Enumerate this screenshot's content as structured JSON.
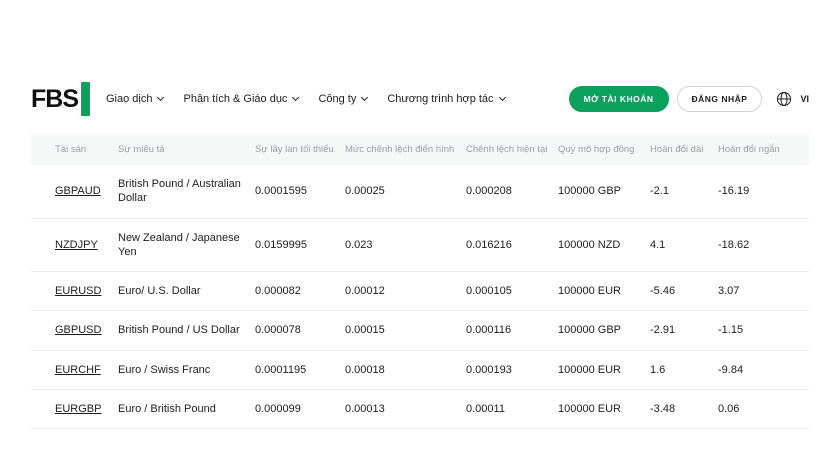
{
  "header": {
    "logo_text": "FBS",
    "nav_items": [
      {
        "label": "Giao dịch"
      },
      {
        "label": "Phân tích & Giáo dục"
      },
      {
        "label": "Công ty"
      },
      {
        "label": "Chương trình hợp tác"
      }
    ],
    "open_account_label": "MỞ TÀI KHOẢN",
    "login_label": "ĐĂNG NHẬP",
    "language": "VI"
  },
  "spreads_table": {
    "columns": [
      "Tài sản",
      "Sự miêu tả",
      "Sự lây lan tối thiểu",
      "Mức chênh lệch điển hình",
      "Chênh lệch hiện tại",
      "Quy mô hợp đồng",
      "Hoán đổi dài",
      "Hoán đổi ngắn"
    ],
    "rows": [
      {
        "symbol": "GBPAUD",
        "description": "British Pound / Australian Dollar",
        "min_spread": "0.0001595",
        "typical_spread": "0.00025",
        "current_spread": "0.000208",
        "contract_size": "100000 GBP",
        "swap_long": "-2.1",
        "swap_short": "-16.19"
      },
      {
        "symbol": "NZDJPY",
        "description": "New Zealand / Japanese Yen",
        "min_spread": "0.0159995",
        "typical_spread": "0.023",
        "current_spread": "0.016216",
        "contract_size": "100000 NZD",
        "swap_long": "4.1",
        "swap_short": "-18.62"
      },
      {
        "symbol": "EURUSD",
        "description": "Euro/ U.S. Dollar",
        "min_spread": "0.000082",
        "typical_spread": "0.00012",
        "current_spread": "0.000105",
        "contract_size": "100000 EUR",
        "swap_long": "-5.46",
        "swap_short": "3.07"
      },
      {
        "symbol": "GBPUSD",
        "description": "British Pound / US Dollar",
        "min_spread": "0.000078",
        "typical_spread": "0.00015",
        "current_spread": "0.000116",
        "contract_size": "100000 GBP",
        "swap_long": "-2.91",
        "swap_short": "-1.15"
      },
      {
        "symbol": "EURCHF",
        "description": "Euro / Swiss Franc",
        "min_spread": "0.0001195",
        "typical_spread": "0.00018",
        "current_spread": "0.000193",
        "contract_size": "100000 EUR",
        "swap_long": "1.6",
        "swap_short": "-9.84"
      },
      {
        "symbol": "EURGBP",
        "description": "Euro / British Pound",
        "min_spread": "0.000099",
        "typical_spread": "0.00013",
        "current_spread": "0.00011",
        "contract_size": "100000 EUR",
        "swap_long": "-3.48",
        "swap_short": "0.06"
      }
    ]
  },
  "colors": {
    "brand_green": "#0aa15c",
    "table_header_bg": "#f6f7f7",
    "table_header_text": "#9aa1a6"
  }
}
